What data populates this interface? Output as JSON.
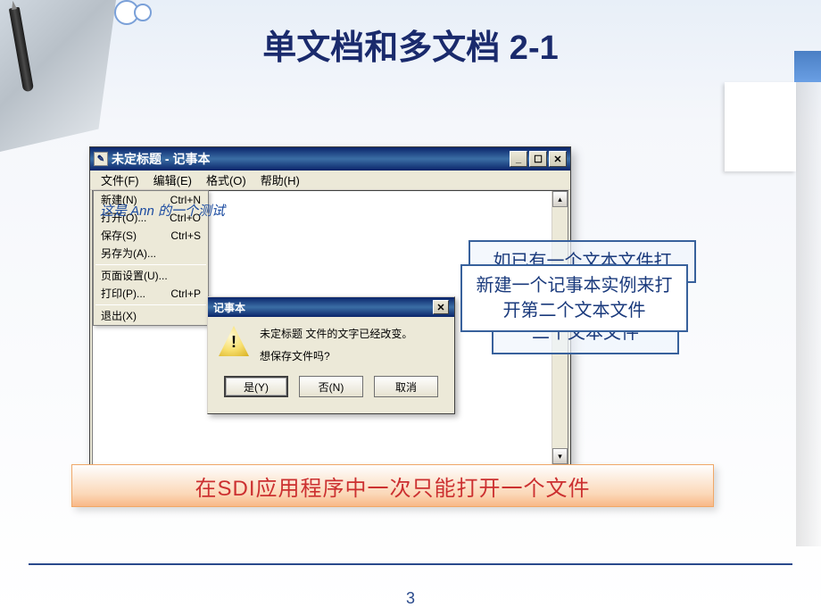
{
  "slide": {
    "title": "单文档和多文档 2-1",
    "page_number": "3"
  },
  "notepad": {
    "title": "未定标题 - 记事本",
    "window_icon_glyph": "✎",
    "menubar": {
      "file": "文件(F)",
      "edit": "编辑(E)",
      "format": "格式(O)",
      "help": "帮助(H)"
    },
    "client_overlay_text": "这是 Ann 的一个测试",
    "scroll_up_glyph": "▴",
    "scroll_down_glyph": "▾",
    "min_glyph": "_",
    "max_glyph": "☐",
    "close_glyph": "✕"
  },
  "file_menu": {
    "items": [
      {
        "label": "新建(N)",
        "accel": "Ctrl+N"
      },
      {
        "label": "打开(O)...",
        "accel": "Ctrl+O"
      },
      {
        "label": "保存(S)",
        "accel": "Ctrl+S"
      },
      {
        "label": "另存为(A)...",
        "accel": ""
      }
    ],
    "items2": [
      {
        "label": "页面设置(U)...",
        "accel": ""
      },
      {
        "label": "打印(P)...",
        "accel": "Ctrl+P"
      }
    ],
    "items3": [
      {
        "label": "退出(X)",
        "accel": ""
      }
    ]
  },
  "dialog": {
    "title": "记事本",
    "line1": "未定标题 文件的文字已经改变。",
    "line2": "想保存文件吗?",
    "yes": "是(Y)",
    "no": "否(N)",
    "cancel": "取消",
    "close_glyph": "✕"
  },
  "callouts": {
    "c1": "如已有一个文本文件打",
    "c2": "新建一个记事本实例来打开第二个文本文件",
    "c3": "二个文本文件"
  },
  "bottom": {
    "text": "在SDI应用程序中一次只能打开一个文件"
  }
}
